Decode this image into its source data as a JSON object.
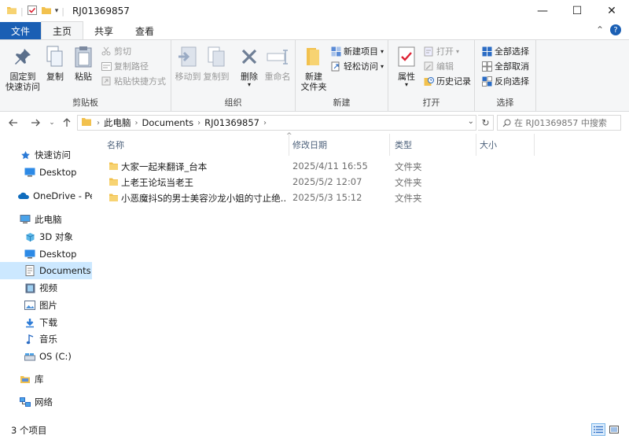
{
  "window": {
    "title": "RJ01369857",
    "minimize_glyph": "—",
    "maximize_glyph": "☐",
    "close_glyph": "✕"
  },
  "ribbon_tabs": [
    {
      "label": "文件"
    },
    {
      "label": "主页"
    },
    {
      "label": "共享"
    },
    {
      "label": "查看"
    }
  ],
  "ribbon": {
    "clipboard": {
      "group_label": "剪贴板",
      "pin_label": "固定到\n快速访问",
      "copy_label": "复制",
      "paste_label": "粘贴",
      "cut_label": "剪切",
      "copy_path_label": "复制路径",
      "paste_shortcut_label": "粘贴快捷方式"
    },
    "organize": {
      "group_label": "组织",
      "move_to_label": "移动到",
      "copy_to_label": "复制到",
      "delete_label": "删除",
      "rename_label": "重命名"
    },
    "new": {
      "group_label": "新建",
      "new_folder_label": "新建\n文件夹",
      "new_item_label": "新建项目",
      "easy_access_label": "轻松访问"
    },
    "open": {
      "group_label": "打开",
      "properties_label": "属性",
      "open_label": "打开",
      "edit_label": "编辑",
      "history_label": "历史记录"
    },
    "select": {
      "group_label": "选择",
      "select_all_label": "全部选择",
      "select_none_label": "全部取消",
      "invert_label": "反向选择"
    }
  },
  "address": {
    "crumbs": [
      "此电脑",
      "Documents",
      "RJ01369857"
    ],
    "search_placeholder": "在 RJ01369857 中搜索"
  },
  "nav_pane": {
    "items": [
      {
        "label": "快速访问",
        "icon": "star-icon"
      },
      {
        "label": "Desktop",
        "icon": "desktop-icon"
      },
      {
        "label": "OneDrive - Per",
        "icon": "cloud-icon"
      },
      {
        "label": "此电脑",
        "icon": "computer-icon"
      },
      {
        "label": "3D 对象",
        "icon": "cube-icon"
      },
      {
        "label": "Desktop",
        "icon": "desktop-icon"
      },
      {
        "label": "Documents",
        "icon": "document-icon"
      },
      {
        "label": "视频",
        "icon": "video-icon"
      },
      {
        "label": "图片",
        "icon": "picture-icon"
      },
      {
        "label": "下载",
        "icon": "download-icon"
      },
      {
        "label": "音乐",
        "icon": "music-icon"
      },
      {
        "label": "OS (C:)",
        "icon": "drive-icon"
      },
      {
        "label": "库",
        "icon": "library-icon"
      },
      {
        "label": "网络",
        "icon": "network-icon"
      }
    ]
  },
  "file_list": {
    "columns": [
      "名称",
      "修改日期",
      "类型",
      "大小"
    ],
    "rows": [
      {
        "name": "大家一起来翻译_台本",
        "date": "2025/4/11 16:55",
        "type": "文件夹",
        "size": ""
      },
      {
        "name": "上老王论坛当老王",
        "date": "2025/5/2 12:07",
        "type": "文件夹",
        "size": ""
      },
      {
        "name": "小恶魔抖S的男士美容沙龙小姐的寸止绝...",
        "date": "2025/5/3 15:12",
        "type": "文件夹",
        "size": ""
      }
    ]
  },
  "status": {
    "item_count": "3 个项目"
  },
  "colors": {
    "file_tab": "#1a5fb4",
    "selected_nav": "#cce8ff",
    "folder": "#f2c14e",
    "column_header_text": "#4c607a"
  }
}
